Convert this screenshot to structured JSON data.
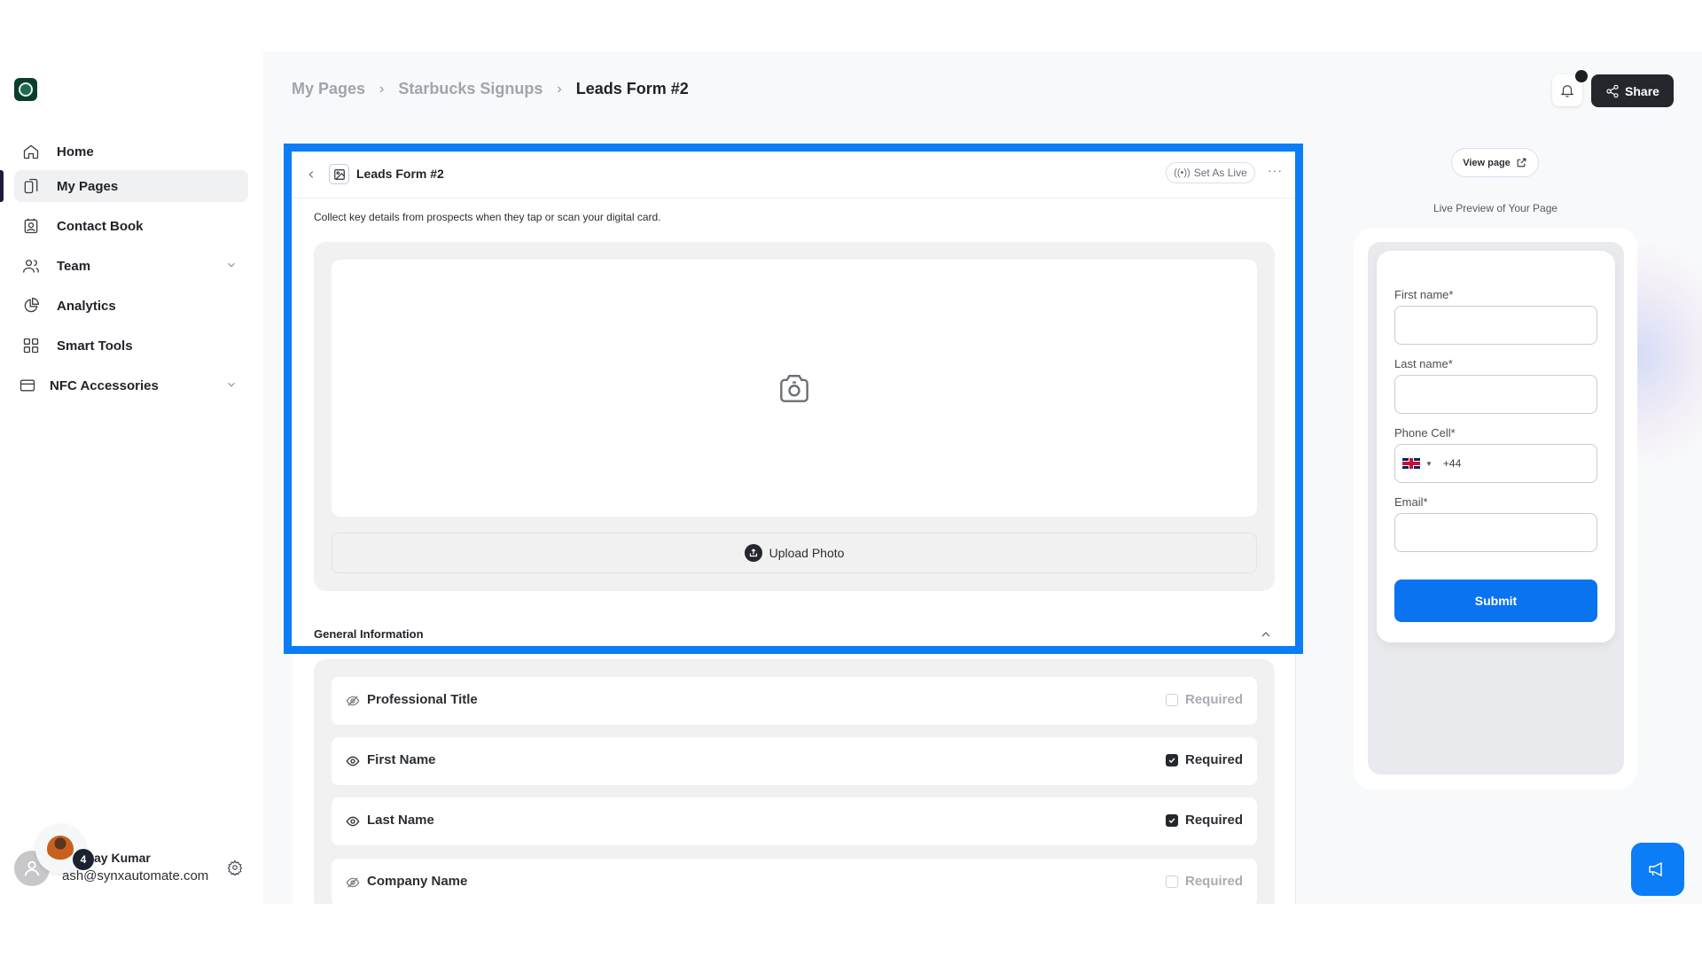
{
  "sidebar": {
    "logo": "starbucks-logo",
    "items": [
      {
        "label": "Home",
        "icon": "home-icon"
      },
      {
        "label": "My Pages",
        "icon": "pages-icon",
        "active": true
      },
      {
        "label": "Contact Book",
        "icon": "contact-book-icon"
      },
      {
        "label": "Team",
        "icon": "team-icon",
        "expandable": true
      },
      {
        "label": "Analytics",
        "icon": "pie-chart-icon"
      },
      {
        "label": "Smart Tools",
        "icon": "grid-icon"
      },
      {
        "label": "NFC Accessories",
        "icon": "card-icon",
        "expandable": true
      }
    ],
    "user": {
      "name": "ay Kumar",
      "email": "ash@synxautomate.com",
      "badge_count": "4"
    }
  },
  "header": {
    "breadcrumb": [
      "My Pages",
      "Starbucks Signups",
      "Leads Form #2"
    ],
    "share_label": "Share",
    "notifications": "bell-icon"
  },
  "editor": {
    "title": "Leads Form #2",
    "set_live_label": "Set As Live",
    "more_label": "···",
    "description": "Collect key details from prospects when they tap or scan your digital card.",
    "upload_label": "Upload Photo",
    "section_title": "General Information",
    "fields": [
      {
        "name": "Professional Title",
        "visible": false,
        "required": false,
        "required_label": "Required"
      },
      {
        "name": "First Name",
        "visible": true,
        "required": true,
        "required_label": "Required"
      },
      {
        "name": "Last Name",
        "visible": true,
        "required": true,
        "required_label": "Required"
      },
      {
        "name": "Company Name",
        "visible": false,
        "required": false,
        "required_label": "Required"
      }
    ]
  },
  "preview": {
    "view_page_label": "View page",
    "caption": "Live Preview of Your Page",
    "form": {
      "first_name_label": "First name*",
      "last_name_label": "Last name*",
      "phone_label": "Phone Cell*",
      "phone_prefix": "+44",
      "email_label": "Email*",
      "submit_label": "Submit"
    }
  },
  "colors": {
    "accent": "#0a7df7",
    "submit": "#0a73f0",
    "dark": "#24272b",
    "logo_bg": "#0b3d2e"
  }
}
